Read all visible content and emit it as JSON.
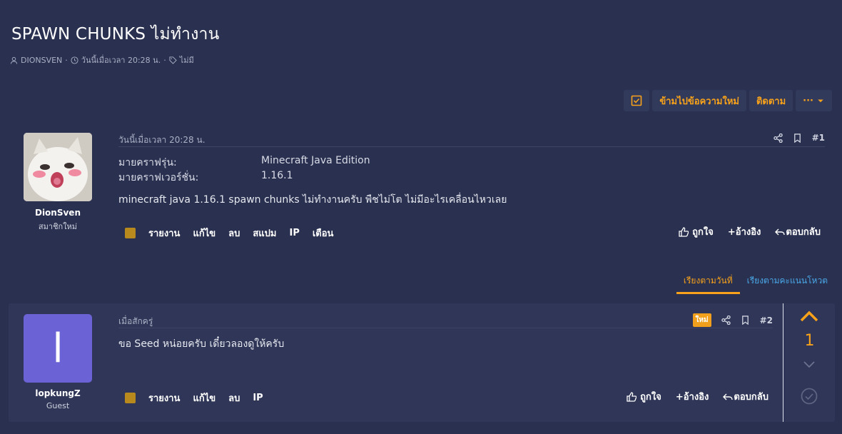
{
  "thread": {
    "title": "SPAWN CHUNKS ไม่ทำงาน",
    "author": "DIONSVEN",
    "date": "วันนี้เมื่อเวลา 20:28 น.",
    "tags": "ไม่มี"
  },
  "actions": {
    "jump_label": "ข้ามไปข้อความใหม่",
    "follow_label": "ติดตาม",
    "more_label": "···"
  },
  "post1": {
    "username": "DionSven",
    "role": "สมาชิกใหม่",
    "date": "วันนี้เมื่อเวลา 20:28 น.",
    "number": "#1",
    "fields": [
      {
        "label": "มายคราฟรุ่น:",
        "value": "Minecraft Java Edition"
      },
      {
        "label": "มายคราฟเวอร์ชั่น:",
        "value": "1.16.1"
      }
    ],
    "body": "minecraft java 1.16.1 spawn chunks ไม่ทำงานครับ พืชไม่โต ไม่มีอะไรเคลื่อนไหวเลย",
    "tools": [
      "รายงาน",
      "แก้ไข",
      "ลบ",
      "สแปม",
      "IP",
      "เตือน"
    ],
    "like": "ถูกใจ",
    "quote": "+อ้างอิง",
    "reply": "ตอบกลับ"
  },
  "sort": {
    "by_date": "เรียงตามวันที่",
    "by_score": "เรียงตามคะแนนโหวต"
  },
  "post2": {
    "avatar_letter": "l",
    "username": "lopkungZ",
    "role": "Guest",
    "date": "เมื่อสักครู่",
    "badge": "ใหม่",
    "number": "#2",
    "body": "ขอ Seed หน่อยครับ เดี๋ยวลองดูให้ครับ",
    "tools": [
      "รายงาน",
      "แก้ไข",
      "ลบ",
      "IP"
    ],
    "like": "ถูกใจ",
    "quote": "+อ้างอิง",
    "reply": "ตอบกลับ",
    "votes": "1"
  },
  "colors": {
    "background": "#2a3050",
    "accent": "#f7a21a",
    "link": "#4aa8e8",
    "avatar2": "#6b62d6"
  }
}
